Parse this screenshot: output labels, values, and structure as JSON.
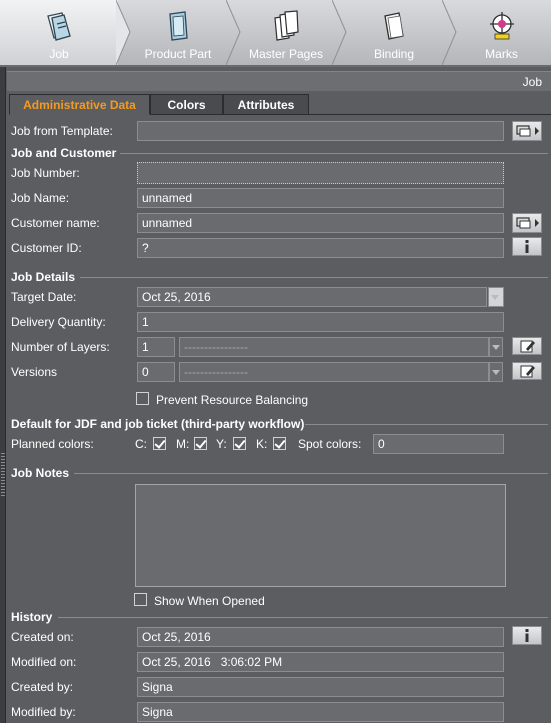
{
  "workflow": {
    "steps": [
      {
        "label": "Job",
        "icon": "job-icon"
      },
      {
        "label": "Product Part",
        "icon": "product-part-icon"
      },
      {
        "label": "Master Pages",
        "icon": "master-pages-icon"
      },
      {
        "label": "Binding",
        "icon": "binding-icon"
      },
      {
        "label": "Marks",
        "icon": "marks-icon"
      }
    ],
    "active": "Job"
  },
  "panel_title": "Job",
  "tabs": [
    "Administrative Data",
    "Colors",
    "Attributes"
  ],
  "active_tab": "Administrative Data",
  "form": {
    "job_from_template": {
      "label": "Job from Template:",
      "value": ""
    },
    "job_and_customer": {
      "title": "Job and Customer",
      "job_number": {
        "label": "Job Number:",
        "value": ""
      },
      "job_name": {
        "label": "Job Name:",
        "value": "unnamed"
      },
      "customer_name": {
        "label": "Customer name:",
        "value": "unnamed"
      },
      "customer_id": {
        "label": "Customer ID:",
        "value": "?"
      }
    },
    "job_details": {
      "title": "Job Details",
      "target_date": {
        "label": "Target Date:",
        "value": "Oct 25, 2016"
      },
      "delivery_quantity": {
        "label": "Delivery Quantity:",
        "value": "1"
      },
      "number_of_layers": {
        "label": "Number of Layers:",
        "value": "1",
        "combo": "----------------"
      },
      "versions": {
        "label": "Versions",
        "value": "0",
        "combo": "----------------"
      },
      "prevent_resource_balancing": {
        "label": "Prevent Resource Balancing",
        "checked": false
      }
    },
    "jdf_defaults": {
      "title": "Default for JDF and job ticket (third-party workflow)",
      "planned_colors_label": "Planned colors:",
      "colors": [
        {
          "label": "C:",
          "checked": true
        },
        {
          "label": "M:",
          "checked": true
        },
        {
          "label": "Y:",
          "checked": true
        },
        {
          "label": "K:",
          "checked": true
        }
      ],
      "spot_colors": {
        "label": "Spot colors:",
        "value": "0"
      }
    },
    "job_notes": {
      "title": "Job Notes",
      "value": "",
      "show_when_opened": {
        "label": "Show When Opened",
        "checked": false
      }
    },
    "history": {
      "title": "History",
      "created_on": {
        "label": "Created on:",
        "value": "Oct 25, 2016"
      },
      "modified_on": {
        "label": "Modified on:",
        "value": "Oct 25, 2016   3:06:02 PM"
      },
      "created_by": {
        "label": "Created by:",
        "value": "Signa"
      },
      "modified_by": {
        "label": "Modified by:",
        "value": "Signa"
      }
    }
  },
  "colors": {
    "background": "#5c5d61",
    "field": "#6a6b6f",
    "active_tab_text": "#f49b1e"
  }
}
